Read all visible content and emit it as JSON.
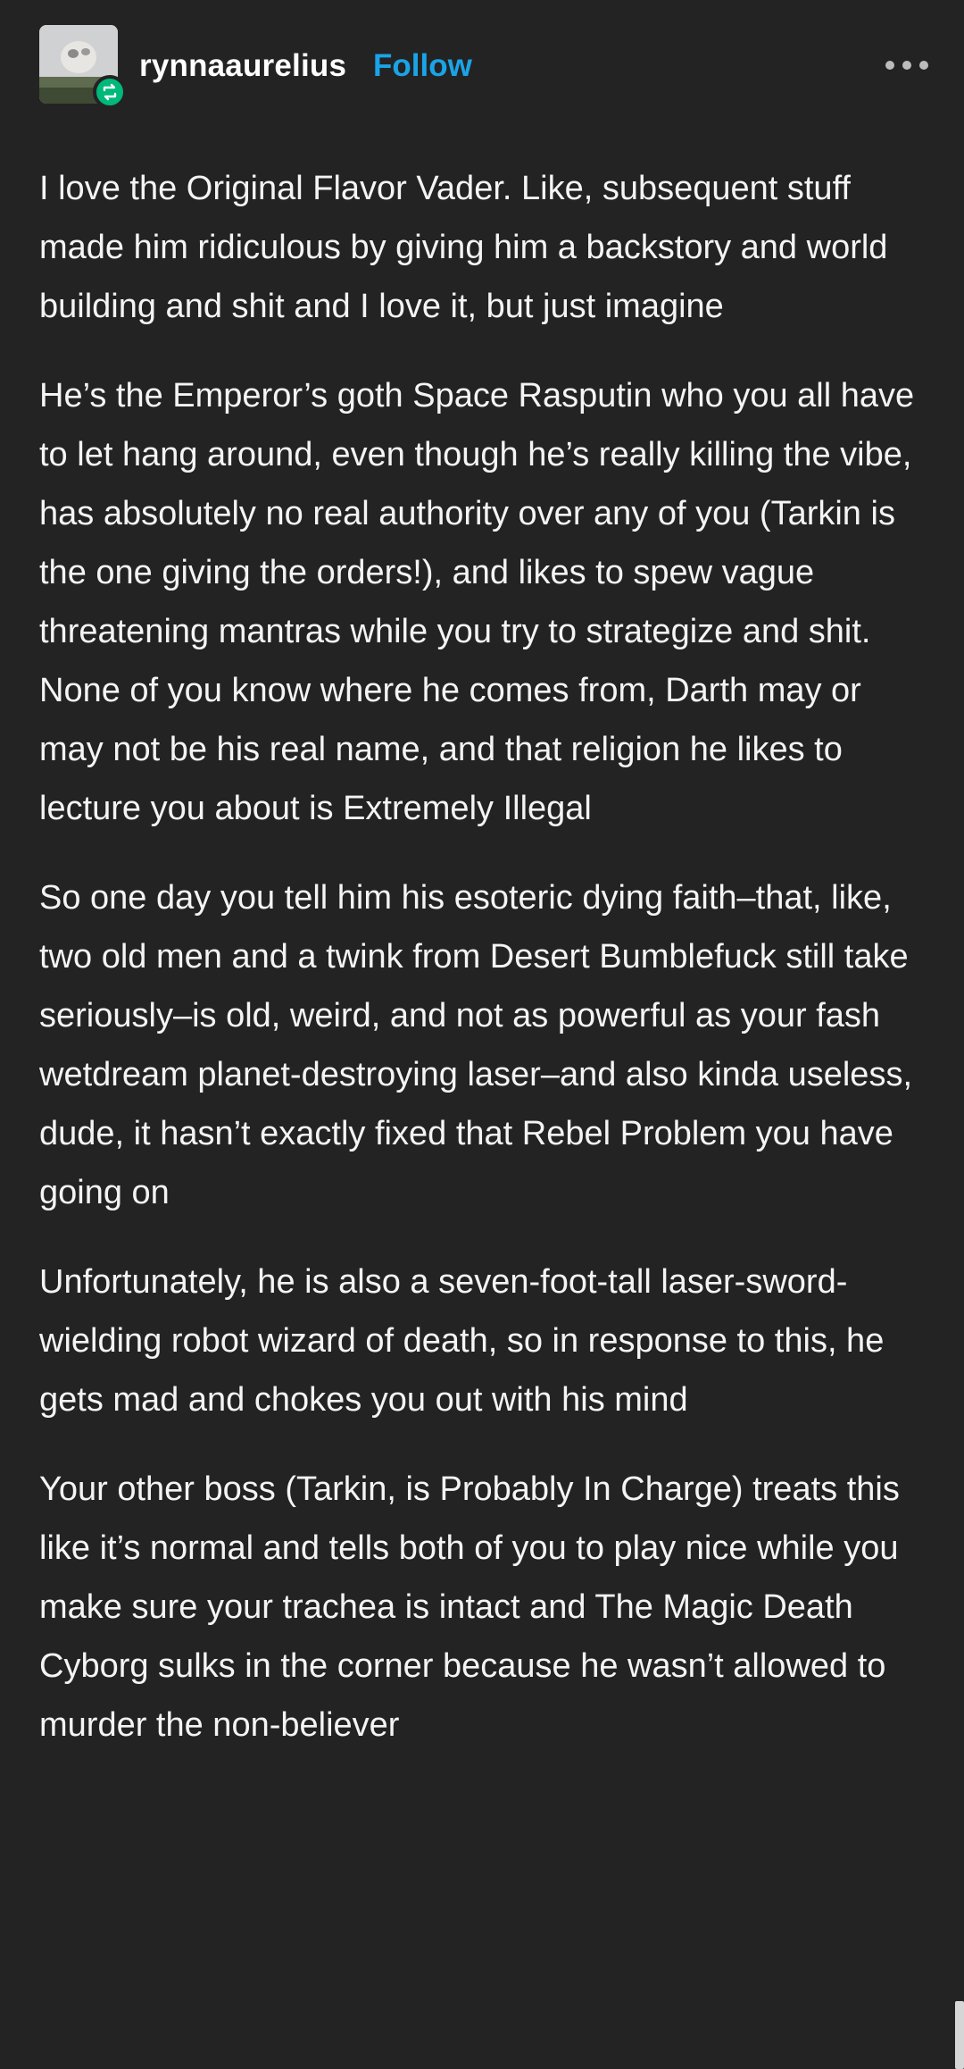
{
  "header": {
    "username": "rynnaaurelius",
    "follow_label": "Follow",
    "avatar_icon": "avatar-image",
    "badge_icon": "reblog-icon",
    "menu_icon": "more-options-icon"
  },
  "colors": {
    "background": "#232323",
    "text": "#f4f4f4",
    "follow": "#1aa4e8",
    "badge": "#00b87a"
  },
  "post": {
    "paragraphs": [
      "I love the Original Flavor Vader. Like, subsequent stuff made him ridiculous by giving him a backstory and world building and shit and I love it, but just imagine",
      "He’s the Emperor’s goth Space Rasputin who you all have to let hang around, even though he’s really killing the vibe, has absolutely no real authority over any of you (Tarkin is the one giving the orders!), and likes to spew vague threatening mantras while you try to strategize and shit. None of you know where he comes from, Darth may or may not be his real name, and that religion he likes to lecture you about is Extremely Illegal",
      "So one day you tell him his esoteric dying faith–that, like, two old men and a twink from Desert Bumblefuck still take seriously–is old, weird, and not as powerful as your fash wetdream planet-destroying laser–and also kinda useless, dude, it hasn’t exactly fixed that Rebel Problem you have going on",
      "Unfortunately, he is also a seven-foot-tall laser-sword-wielding robot wizard of death, so in response to this, he gets mad and chokes you out with his mind",
      "Your other boss (Tarkin, is Probably In Charge) treats this like it’s normal and tells both of you to play nice while you make sure your trachea is intact and The Magic Death Cyborg sulks in the corner because he wasn’t allowed to murder the non-believer"
    ]
  }
}
